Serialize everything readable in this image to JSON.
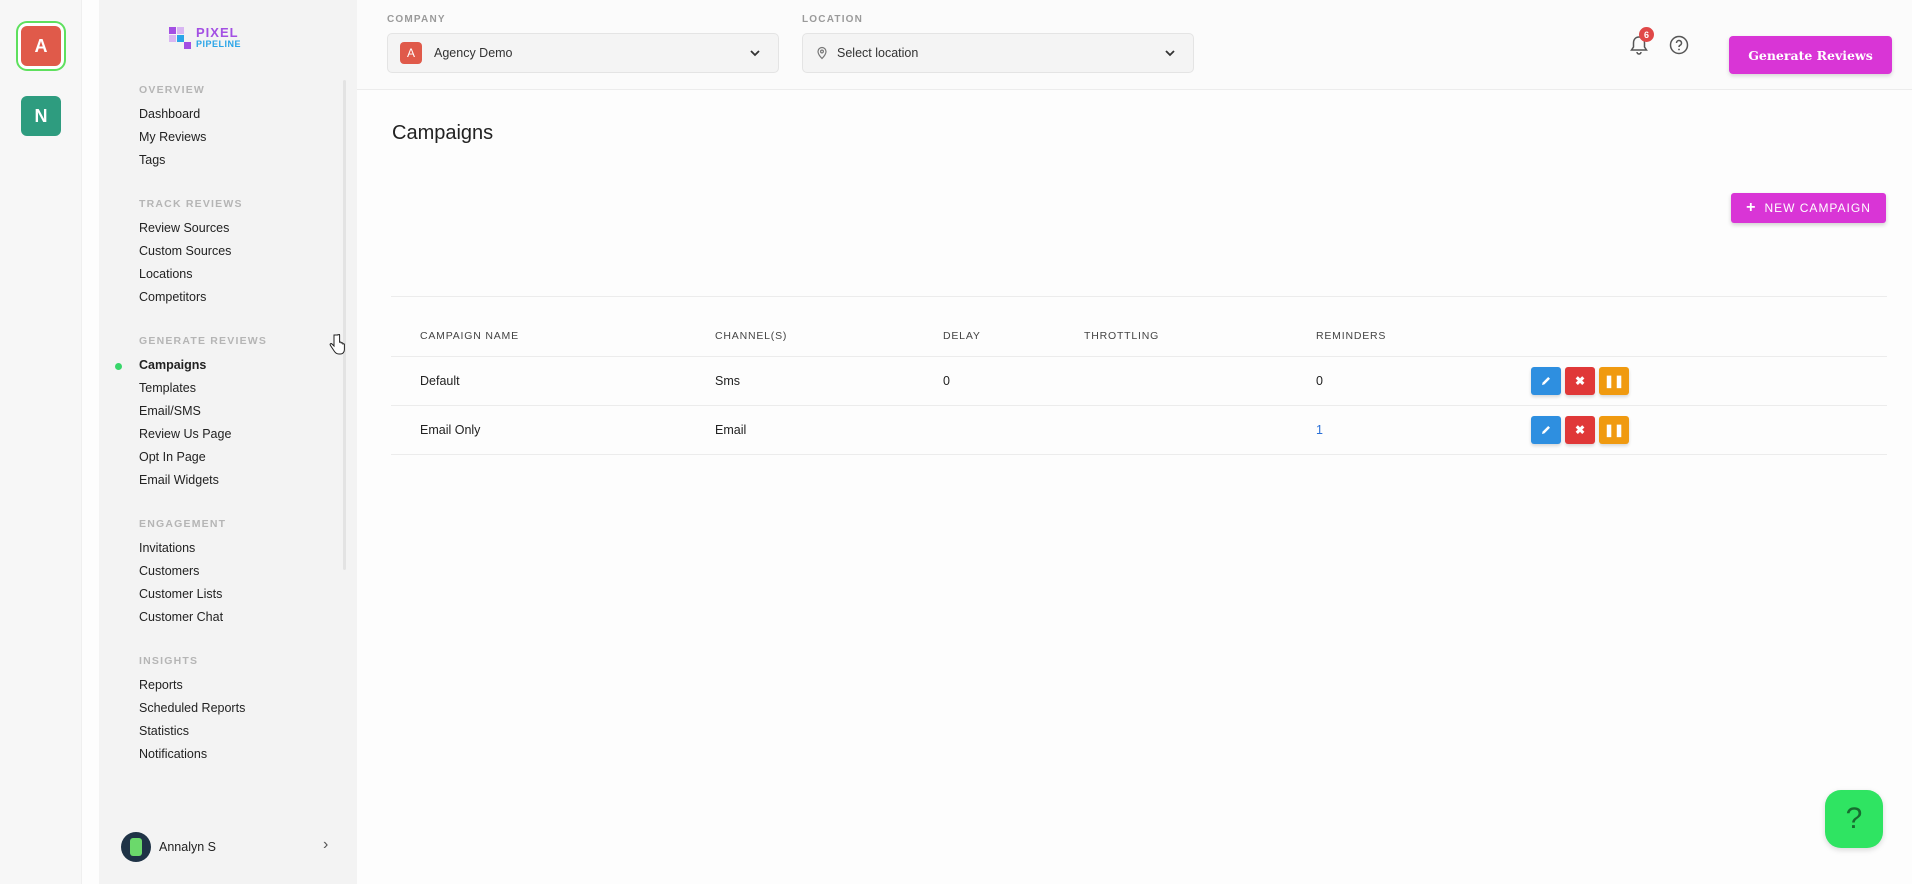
{
  "accounts": [
    {
      "initial": "A",
      "color": "#e05a4a",
      "selected": true
    },
    {
      "initial": "N",
      "color": "#2e9c7f",
      "selected": false
    }
  ],
  "logo": {
    "line1": "PIXEL",
    "line2": "PIPELINE"
  },
  "sidebar": {
    "sections": [
      {
        "title": "OVERVIEW",
        "items": [
          "Dashboard",
          "My Reviews",
          "Tags"
        ]
      },
      {
        "title": "TRACK REVIEWS",
        "items": [
          "Review Sources",
          "Custom Sources",
          "Locations",
          "Competitors"
        ]
      },
      {
        "title": "GENERATE REVIEWS",
        "items": [
          "Campaigns",
          "Templates",
          "Email/SMS",
          "Review Us Page",
          "Opt In Page",
          "Email Widgets"
        ]
      },
      {
        "title": "ENGAGEMENT",
        "items": [
          "Invitations",
          "Customers",
          "Customer Lists",
          "Customer Chat"
        ]
      },
      {
        "title": "INSIGHTS",
        "items": [
          "Reports",
          "Scheduled Reports",
          "Statistics",
          "Notifications"
        ]
      }
    ],
    "active_item": "Campaigns",
    "user_name": "Annalyn S"
  },
  "topbar": {
    "company_label": "COMPANY",
    "company_initial": "A",
    "company_value": "Agency Demo",
    "location_label": "LOCATION",
    "location_placeholder": "Select location",
    "notification_count": "6",
    "generate_button": "Generate Reviews"
  },
  "main": {
    "title": "Campaigns",
    "new_campaign_button": "NEW CAMPAIGN",
    "columns": [
      "CAMPAIGN NAME",
      "CHANNEL(S)",
      "DELAY",
      "THROTTLING",
      "REMINDERS"
    ],
    "rows": [
      {
        "name": "Default",
        "channels": "Sms",
        "delay": "0",
        "throttling": "",
        "reminders": "0"
      },
      {
        "name": "Email Only",
        "channels": "Email",
        "delay": "",
        "throttling": "",
        "reminders": "1"
      }
    ]
  },
  "colors": {
    "accent": "#d935d6",
    "active_dot": "#38d66a",
    "help_fab": "#2fe462"
  },
  "help_fab_label": "?"
}
